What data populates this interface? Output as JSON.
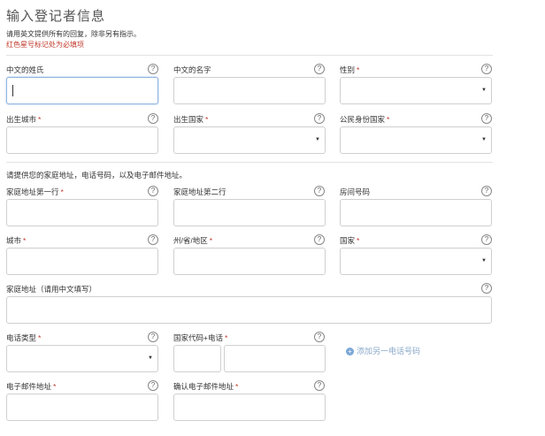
{
  "header": {
    "title": "输入登记者信息",
    "intro": "请用英文提供所有的回复，除非另有指示。",
    "required_note": "红色星号标记处为必填项"
  },
  "help_glyph": "?",
  "row1": {
    "surname_cn": "中文的姓氏",
    "given_cn": "中文的名字",
    "gender": "性别"
  },
  "row2": {
    "birth_city": "出生城市",
    "birth_country": "出生国家",
    "citizenship": "公民身份国家"
  },
  "contact_note": "请提供您的家庭地址，电话号码，以及电子邮件地址。",
  "row3": {
    "address1": "家庭地址第一行",
    "address2": "家庭地址第二行",
    "room": "房间号码"
  },
  "row4": {
    "city": "城市",
    "state": "州/省/地区",
    "country": "国家"
  },
  "row5": {
    "address_cn": "家庭地址（请用中文填写）"
  },
  "row6": {
    "phone_type": "电话类型",
    "phone_code": "国家代码+电话",
    "add_phone": "添加另一电话号码"
  },
  "row7": {
    "email": "电子邮件地址",
    "email_confirm": "确认电子邮件地址"
  },
  "required_star": "*",
  "select_arrow": "▼",
  "plus_glyph": "+"
}
